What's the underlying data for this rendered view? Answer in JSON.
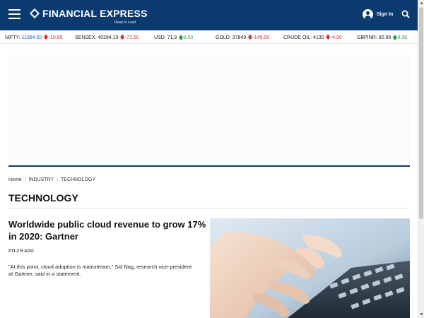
{
  "header": {
    "brand": "FINANCIAL EXPRESS",
    "tagline": "Read to Lead",
    "signin_label": "Sign In",
    "bg_color": "#0b3a6e"
  },
  "ticker": [
    {
      "name": "NIFTY:",
      "value": "11884.50",
      "direction": "down",
      "change": "-10.85"
    },
    {
      "name": "SENSEX:",
      "value": "40284.19",
      "direction": "down",
      "change": "-72.50"
    },
    {
      "name": "USD:",
      "value": "71.9",
      "direction": "up",
      "change": "0.03"
    },
    {
      "name": "GOLD:",
      "value": "37849",
      "direction": "down",
      "change": "-145.00"
    },
    {
      "name": "CRUDE OIL:",
      "value": "4130",
      "direction": "down",
      "change": "-4.00"
    },
    {
      "name": "GBPINR:",
      "value": "92.95",
      "direction": "up",
      "change": "0.36"
    }
  ],
  "breadcrumb": [
    "Home",
    "INDUSTRY",
    "TECHNOLOGY"
  ],
  "section_title": "TECHNOLOGY",
  "article": {
    "headline": "Worldwide public cloud revenue to grow 17% in 2020: Gartner",
    "byline": "PTI·2 H AGO",
    "summary": "\"At this point, cloud adoption is mainstream,\" Sid Nag, research vice-president at Gartner, said in a statement."
  },
  "icons": {
    "menu": "hamburger-menu-icon",
    "user": "user-icon",
    "search": "search-icon",
    "down": "arrow-down-icon",
    "up": "arrow-up-icon"
  },
  "colors": {
    "down": "#d32f2f",
    "up": "#1e9e3e",
    "accent_rule": "#0b3a6e"
  }
}
